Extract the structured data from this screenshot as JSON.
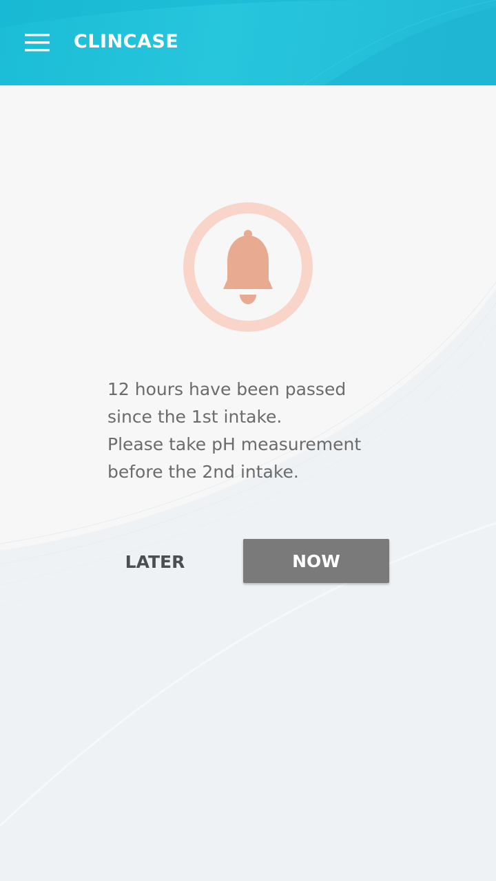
{
  "app_bar": {
    "title": "CLINCASE",
    "menu_icon": "hamburger-menu-icon",
    "color": "#22c0da"
  },
  "alert": {
    "icon": "bell-icon",
    "icon_color": "#e8ab92",
    "ring_color": "#f8d5c8",
    "message_lines": [
      "12 hours have been passed",
      "since the 1st intake.",
      "Please take pH measurement",
      "before the 2nd intake."
    ]
  },
  "actions": {
    "later_label": "LATER",
    "now_label": "NOW",
    "now_color": "#7a7a7a"
  }
}
